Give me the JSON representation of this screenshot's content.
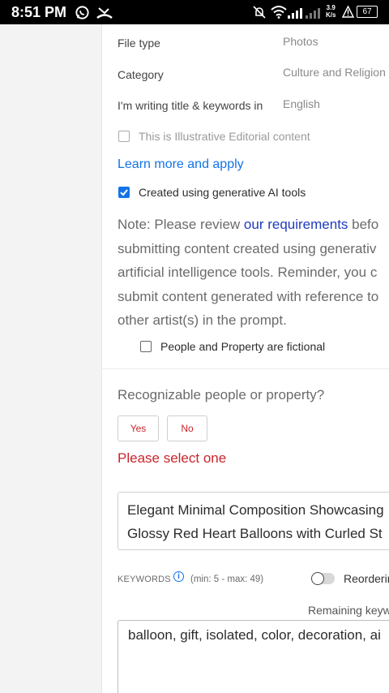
{
  "status_bar": {
    "time": "8:51 PM",
    "net_speed_top": "3.9",
    "net_speed_bottom": "K/s",
    "battery": "67"
  },
  "meta": {
    "file_type_label": "File type",
    "file_type_value": "Photos",
    "category_label": "Category",
    "category_value": "Culture and Religion",
    "language_label": "I'm writing title & keywords in",
    "language_value": "English"
  },
  "editorial_checkbox_label": "This is Illustrative Editorial content",
  "learn_more_link": "Learn more and apply",
  "gen_ai_checkbox_label": "Created using generative AI tools",
  "note": {
    "line1_prefix": "Note: Please review ",
    "line1_link": "our requirements",
    "line1_suffix": " befo",
    "line2": "submitting content created using generativ",
    "line3": "artificial intelligence tools. Reminder, you c",
    "line4": "submit content generated with reference to",
    "line5": "other artist(s) in the prompt."
  },
  "fictional_checkbox_label": "People and Property are fictional",
  "recognizable_question": "Recognizable people or property?",
  "yes_button": "Yes",
  "no_button": "No",
  "error_text": "Please select one",
  "title_field": {
    "line1": "Elegant Minimal Composition Showcasing",
    "line2": "Glossy Red Heart Balloons with Curled St"
  },
  "keywords": {
    "label": "KEYWORDS",
    "info_icon_glyph": "i",
    "limits": "(min: 5 - max: 49)",
    "reorder_label": "Reorderin",
    "remaining_label": "Remaining keyw",
    "value": "balloon, gift, isolated, color, decoration, ai"
  },
  "colors": {
    "accent_blue": "#1473e6",
    "link_dark_blue": "#1f3bbd",
    "error_red": "#c9252c"
  }
}
